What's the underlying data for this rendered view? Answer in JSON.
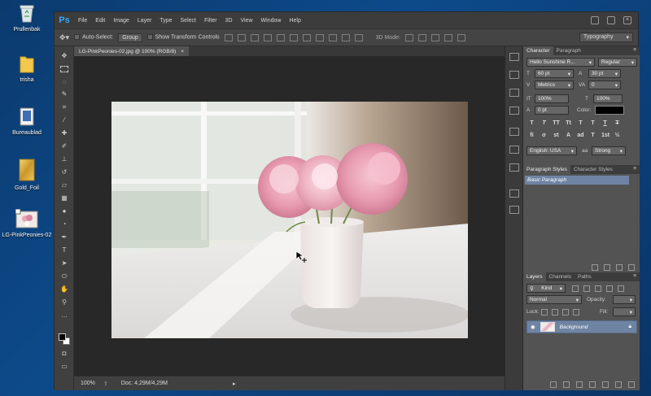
{
  "desktop": {
    "icons": [
      {
        "label": "Prullenbak"
      },
      {
        "label": "trisha"
      },
      {
        "label": "Bureaublad"
      },
      {
        "label": "Gold_Foil"
      },
      {
        "label": "LG-PinkPeonies-02"
      }
    ]
  },
  "app": {
    "logo": "Ps",
    "menu": [
      "File",
      "Edit",
      "Image",
      "Layer",
      "Type",
      "Select",
      "Filter",
      "3D",
      "View",
      "Window",
      "Help"
    ]
  },
  "options": {
    "auto_select_label": "Auto-Select:",
    "auto_select_value": "Group",
    "show_transform_label": "Show Transform Controls",
    "mode_3d_label": "3D Mode:",
    "workspace": "Typography"
  },
  "document": {
    "tab_title": "LG-PinkPeonies-02.jpg @ 100% (RGB/8)",
    "tab_close": "×",
    "zoom": "100%",
    "doc_size": "Doc: 4,29M/4,29M"
  },
  "character": {
    "tabs": [
      "Character",
      "Paragraph"
    ],
    "font_family": "Hello Sunshine R...",
    "font_style": "Regular",
    "font_size": "60 pt",
    "leading": "30 pt",
    "kerning": "Metrics",
    "tracking": "0",
    "vscale": "100%",
    "hscale": "100%",
    "baseline": "0 pt",
    "color_label": "Color:",
    "language": "English: USA",
    "antialias": "Strong",
    "typo_buttons": [
      "T",
      "T",
      "TT",
      "Tt",
      "T",
      "T",
      "T",
      "T"
    ],
    "ot_buttons": [
      "fi",
      "σ",
      "st",
      "A",
      "ad",
      "T",
      "1st",
      "½"
    ]
  },
  "para_styles": {
    "tabs": [
      "Paragraph Styles",
      "Character Styles"
    ],
    "items": [
      "Basic Paragraph"
    ]
  },
  "layers": {
    "tabs": [
      "Layers",
      "Channels",
      "Paths"
    ],
    "filter_kind": "Kind",
    "blend_mode": "Normal",
    "opacity_label": "Opacity:",
    "lock_label": "Lock:",
    "fill_label": "Fill:",
    "layer_name": "Background"
  },
  "colors": {
    "accent": "#31a8ff",
    "selected_layer": "#6f84a3"
  }
}
